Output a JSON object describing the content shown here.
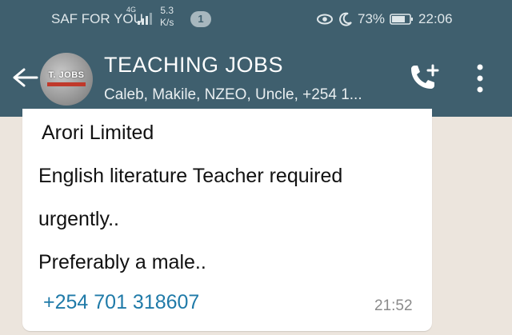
{
  "status_bar": {
    "carrier": "SAF FOR YOU",
    "network": "4G",
    "speed_value": "5.3",
    "speed_unit": "K/s",
    "notification_count": "1",
    "battery": "73%",
    "time": "22:06"
  },
  "header": {
    "avatar_text": "T. JOBS",
    "title": "TEACHING JOBS",
    "subtitle": "Caleb, Makile, NZEO, Uncle, +254 1..."
  },
  "message": {
    "line1": "Arori Limited",
    "line2": "English literature Teacher required",
    "line3": "urgently..",
    "line4": "Preferably a male..",
    "phone": "+254 701 318607",
    "time": "21:52"
  },
  "colors": {
    "header_bg": "#3f5f6e",
    "chat_bg": "#ece5dd",
    "link": "#1f7aa8"
  }
}
